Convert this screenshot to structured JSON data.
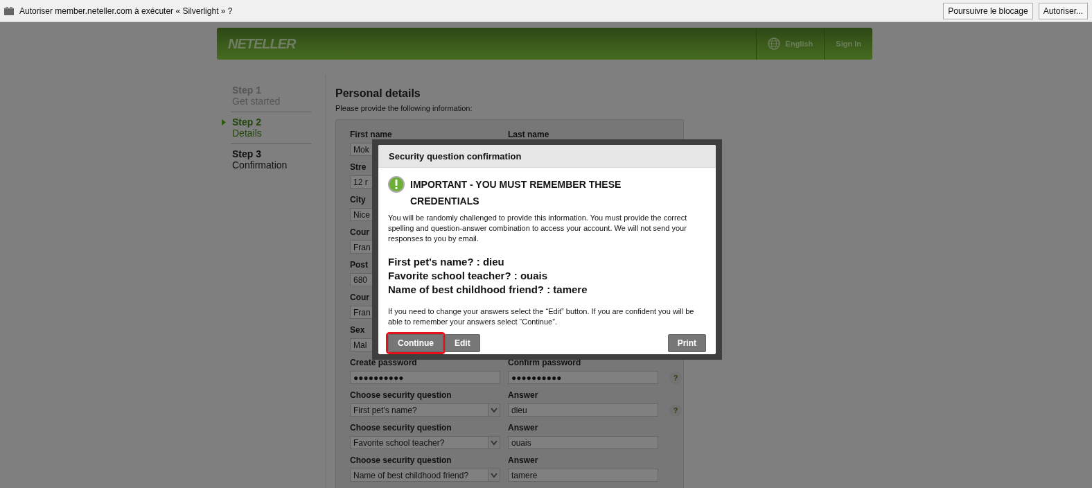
{
  "notification_bar": {
    "message": "Autoriser member.neteller.com à exécuter « Silverlight » ?",
    "buttons": [
      "Poursuivre le blocage",
      "Autoriser..."
    ]
  },
  "header": {
    "logo": "NETELLER",
    "language": "English",
    "sign_in": "Sign In"
  },
  "steps": [
    {
      "step": "Step 1",
      "label": "Get started",
      "selected": false,
      "completed": true
    },
    {
      "step": "Step 2",
      "label": "Details",
      "selected": true,
      "completed": false
    },
    {
      "step": "Step 3",
      "label": "Confirmation",
      "selected": false,
      "completed": false
    }
  ],
  "form": {
    "title": "Personal details",
    "subtitle": "Please provide the following information:",
    "rows": [
      {
        "left": {
          "label": "First name",
          "value": "Mok",
          "kind": "text"
        },
        "right": {
          "label": "Last name"
        }
      },
      {
        "left": {
          "label": "Stre",
          "value": "12 r",
          "kind": "text"
        }
      },
      {
        "left": {
          "label": "City",
          "value": "Nice",
          "kind": "text"
        }
      },
      {
        "left": {
          "label": "Cour",
          "value": "Fran",
          "kind": "text"
        }
      },
      {
        "left": {
          "label": "Post",
          "value": "680",
          "kind": "text"
        }
      },
      {
        "left": {
          "label": "Cour",
          "value": "Fran",
          "kind": "text"
        }
      },
      {
        "left": {
          "label": "Sex",
          "value": "Mal",
          "kind": "text"
        }
      },
      {
        "left": {
          "label": "Create password",
          "value": "●●●●●●●●●●",
          "kind": "text"
        },
        "right": {
          "label": "Confirm password",
          "value": "●●●●●●●●●●",
          "help": "?"
        }
      },
      {
        "left": {
          "label": "Choose security question",
          "value": "First pet's name?",
          "kind": "select"
        },
        "right": {
          "label": "Answer",
          "value": "dieu",
          "help": "?"
        }
      },
      {
        "left": {
          "label": "Choose security question",
          "value": "Favorite school teacher?",
          "kind": "select"
        },
        "right": {
          "label": "Answer",
          "value": "ouais"
        }
      },
      {
        "left": {
          "label": "Choose security question",
          "value": "Name of best childhood friend?",
          "kind": "select"
        },
        "right": {
          "label": "Answer",
          "value": "tamere"
        }
      }
    ]
  },
  "dialog": {
    "title": "Security question confirmation",
    "heading": "IMPORTANT - YOU MUST REMEMBER THESE CREDENTIALS",
    "intro": "You will be randomly challenged to provide this information. You must provide the correct spelling and question-answer combination to access your account. We will not send your responses to you by email.",
    "answers": [
      "First pet's name? : dieu",
      "Favorite school teacher? : ouais",
      "Name of best childhood friend? : tamere"
    ],
    "note": "If you need to change your answers select the “Edit” button. If you are confident you will be able to remember your answers select “Continue”.",
    "buttons": [
      {
        "label": "Continue",
        "highlighted": true
      },
      {
        "label": "Edit",
        "highlighted": false
      },
      {
        "label": "Print",
        "highlighted": false
      }
    ]
  }
}
